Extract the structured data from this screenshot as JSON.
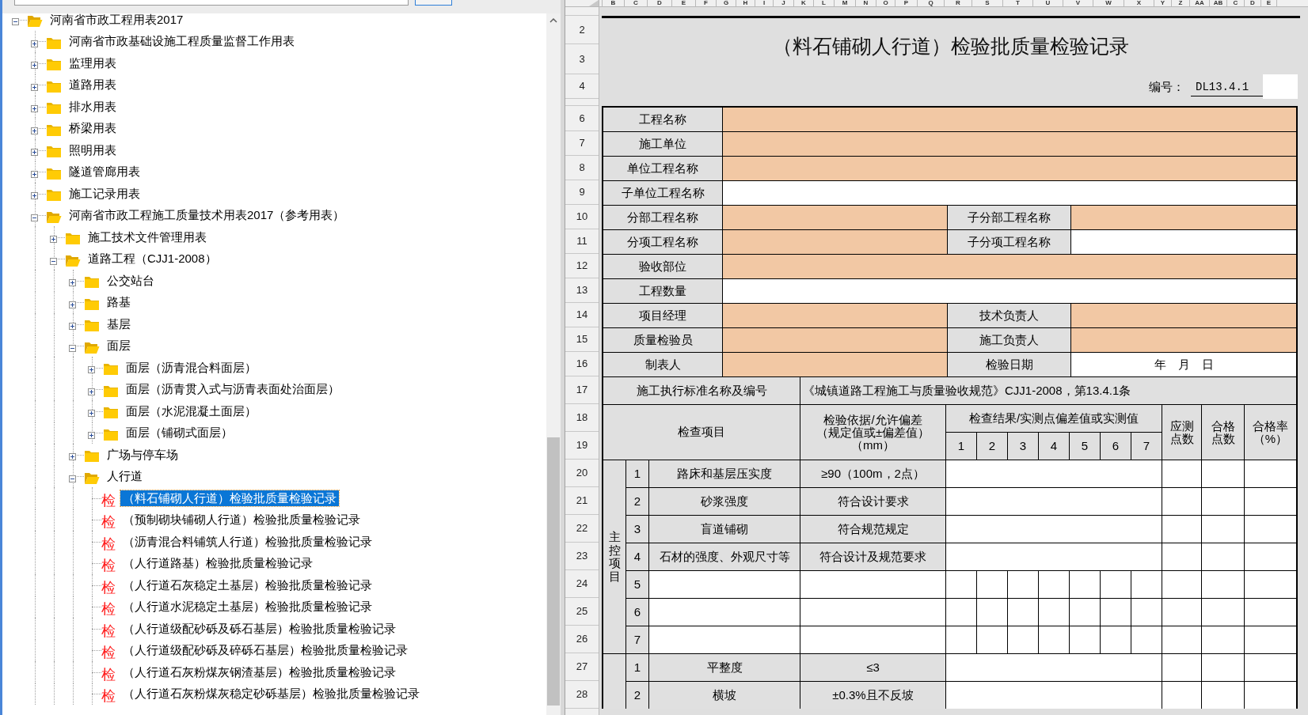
{
  "tree": {
    "label": "河南省市政工程用表2017",
    "kind": "folder",
    "expanded": true,
    "selected": false,
    "children": [
      {
        "label": "河南省市政基础设施工程质量监督工作用表",
        "kind": "folder",
        "expanded": false,
        "selected": false
      },
      {
        "label": "监理用表",
        "kind": "folder",
        "expanded": false,
        "selected": false
      },
      {
        "label": "道路用表",
        "kind": "folder",
        "expanded": false,
        "selected": false
      },
      {
        "label": "排水用表",
        "kind": "folder",
        "expanded": false,
        "selected": false
      },
      {
        "label": "桥梁用表",
        "kind": "folder",
        "expanded": false,
        "selected": false
      },
      {
        "label": "照明用表",
        "kind": "folder",
        "expanded": false,
        "selected": false
      },
      {
        "label": "隧道管廊用表",
        "kind": "folder",
        "expanded": false,
        "selected": false
      },
      {
        "label": "施工记录用表",
        "kind": "folder",
        "expanded": false,
        "selected": false
      },
      {
        "label": "河南省市政工程施工质量技术用表2017（参考用表）",
        "kind": "folder",
        "expanded": true,
        "selected": false,
        "children": [
          {
            "label": "施工技术文件管理用表",
            "kind": "folder",
            "expanded": false,
            "selected": false
          },
          {
            "label": "道路工程（CJJ1-2008）",
            "kind": "folder",
            "expanded": true,
            "selected": false,
            "children": [
              {
                "label": "公交站台",
                "kind": "folder",
                "expanded": false,
                "selected": false
              },
              {
                "label": "路基",
                "kind": "folder",
                "expanded": false,
                "selected": false
              },
              {
                "label": "基层",
                "kind": "folder",
                "expanded": false,
                "selected": false
              },
              {
                "label": "面层",
                "kind": "folder",
                "expanded": true,
                "selected": false,
                "children": [
                  {
                    "label": "面层（沥青混合料面层）",
                    "kind": "folder",
                    "expanded": false,
                    "selected": false
                  },
                  {
                    "label": "面层（沥青贯入式与沥青表面处治面层）",
                    "kind": "folder",
                    "expanded": false,
                    "selected": false
                  },
                  {
                    "label": "面层（水泥混凝土面层）",
                    "kind": "folder",
                    "expanded": false,
                    "selected": false
                  },
                  {
                    "label": "面层（铺砌式面层）",
                    "kind": "folder",
                    "expanded": false,
                    "selected": false
                  }
                ]
              },
              {
                "label": "广场与停车场",
                "kind": "folder",
                "expanded": false,
                "selected": false
              },
              {
                "label": "人行道",
                "kind": "folder",
                "expanded": true,
                "selected": false,
                "children": [
                  {
                    "label": "（料石铺砌人行道）检验批质量检验记录",
                    "kind": "form",
                    "badge": "检",
                    "selected": true
                  },
                  {
                    "label": "（预制砌块铺砌人行道）检验批质量检验记录",
                    "kind": "form",
                    "badge": "检",
                    "selected": false
                  },
                  {
                    "label": "（沥青混合料铺筑人行道）检验批质量检验记录",
                    "kind": "form",
                    "badge": "检",
                    "selected": false
                  },
                  {
                    "label": "（人行道路基）检验批质量检验记录",
                    "kind": "form",
                    "badge": "检",
                    "selected": false
                  },
                  {
                    "label": "（人行道石灰稳定土基层）检验批质量检验记录",
                    "kind": "form",
                    "badge": "检",
                    "selected": false
                  },
                  {
                    "label": "（人行道水泥稳定土基层）检验批质量检验记录",
                    "kind": "form",
                    "badge": "检",
                    "selected": false
                  },
                  {
                    "label": "（人行道级配砂砾及砾石基层）检验批质量检验记录",
                    "kind": "form",
                    "badge": "检",
                    "selected": false
                  },
                  {
                    "label": "（人行道级配砂砾及碎砾石基层）检验批质量检验记录",
                    "kind": "form",
                    "badge": "检",
                    "selected": false
                  },
                  {
                    "label": "（人行道石灰粉煤灰钢渣基层）检验批质量检验记录",
                    "kind": "form",
                    "badge": "检",
                    "selected": false
                  },
                  {
                    "label": "（人行道石灰粉煤灰稳定砂砾基层）检验批质量检验记录",
                    "kind": "form",
                    "badge": "检",
                    "selected": false
                  }
                ]
              }
            ]
          }
        ]
      }
    ]
  },
  "sheet": {
    "column_headers": [
      "B",
      "C",
      "D",
      "E",
      "F",
      "G",
      "H",
      "I",
      "J",
      "K",
      "L",
      "M",
      "N",
      "O",
      "P",
      "Q",
      "R",
      "S",
      "T",
      "U",
      "V",
      "W",
      "X",
      "Y",
      "Z",
      "AA",
      "AB",
      "C",
      "D",
      "E"
    ],
    "row_numbers": [
      "2",
      "3",
      "4",
      "6",
      "7",
      "8",
      "9",
      "10",
      "11",
      "12",
      "13",
      "14",
      "15",
      "16",
      "17",
      "18",
      "19",
      "20",
      "21",
      "22",
      "23",
      "24",
      "25",
      "26",
      "27",
      "28"
    ],
    "title": "（料石铺砌人行道）检验批质量检验记录",
    "code_label": "编号：",
    "code_value": "DL13.4.1",
    "info_rows": [
      {
        "cells": [
          {
            "kind": "label",
            "text": "工程名称"
          },
          {
            "kind": "required"
          }
        ]
      },
      {
        "cells": [
          {
            "kind": "label",
            "text": "施工单位"
          },
          {
            "kind": "required"
          }
        ]
      },
      {
        "cells": [
          {
            "kind": "label",
            "text": "单位工程名称"
          },
          {
            "kind": "required"
          }
        ]
      },
      {
        "cells": [
          {
            "kind": "label",
            "text": "子单位工程名称"
          },
          {
            "kind": "open"
          }
        ]
      },
      {
        "cells": [
          {
            "kind": "label",
            "text": "分部工程名称"
          },
          {
            "kind": "required"
          },
          {
            "kind": "label",
            "text": "子分部工程名称"
          },
          {
            "kind": "required"
          }
        ]
      },
      {
        "cells": [
          {
            "kind": "label",
            "text": "分项工程名称"
          },
          {
            "kind": "required"
          },
          {
            "kind": "label",
            "text": "子分项工程名称"
          },
          {
            "kind": "open"
          }
        ]
      },
      {
        "cells": [
          {
            "kind": "label",
            "text": "验收部位"
          },
          {
            "kind": "required"
          }
        ]
      },
      {
        "cells": [
          {
            "kind": "label",
            "text": "工程数量"
          },
          {
            "kind": "open"
          }
        ]
      },
      {
        "cells": [
          {
            "kind": "label",
            "text": "项目经理"
          },
          {
            "kind": "required"
          },
          {
            "kind": "label",
            "text": "技术负责人"
          },
          {
            "kind": "required"
          }
        ]
      },
      {
        "cells": [
          {
            "kind": "label",
            "text": "质量检验员"
          },
          {
            "kind": "required"
          },
          {
            "kind": "label",
            "text": "施工负责人"
          },
          {
            "kind": "required"
          }
        ]
      },
      {
        "cells": [
          {
            "kind": "label",
            "text": "制表人"
          },
          {
            "kind": "required"
          },
          {
            "kind": "label",
            "text": "检验日期"
          },
          {
            "kind": "open",
            "text": "年　月　日"
          }
        ]
      }
    ],
    "standard": {
      "label": "施工执行标准名称及编号",
      "value": "《城镇道路工程施工与质量验收规范》CJJ1-2008，第13.4.1条"
    },
    "header": {
      "item": "检查项目",
      "basis": [
        "检验依据/允许偏差",
        "（规定值或±偏差值）",
        "（mm）"
      ],
      "results": "检查结果/实测点偏差值或实测值",
      "points": [
        "1",
        "2",
        "3",
        "4",
        "5",
        "6",
        "7"
      ],
      "required_points": [
        "应测",
        "点数"
      ],
      "passed_points": [
        "合格",
        "点数"
      ],
      "pass_rate": [
        "合格率",
        "（%）"
      ]
    },
    "groups": [
      {
        "label": "主控项目",
        "items": [
          {
            "no": "1",
            "kind": "preset",
            "name": "路床和基层压实度",
            "basis": "≥90（100m，2点）"
          },
          {
            "no": "2",
            "kind": "preset",
            "name": "砂浆强度",
            "basis": "符合设计要求"
          },
          {
            "no": "3",
            "kind": "preset",
            "name": "盲道铺砌",
            "basis": "符合规范规定"
          },
          {
            "no": "4",
            "kind": "preset",
            "name": "石材的强度、外观尺寸等",
            "basis": "符合设计及规范要求"
          },
          {
            "no": "5",
            "kind": "open"
          },
          {
            "no": "6",
            "kind": "open"
          },
          {
            "no": "7",
            "kind": "open"
          }
        ]
      },
      {
        "items": [
          {
            "no": "1",
            "kind": "preset",
            "name": "平整度",
            "basis": "≤3"
          },
          {
            "no": "2",
            "kind": "preset",
            "name": "横坡",
            "basis": "±0.3%且不反坡"
          }
        ]
      }
    ]
  }
}
